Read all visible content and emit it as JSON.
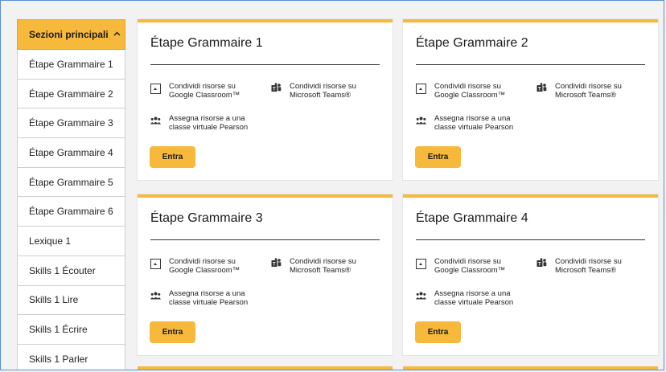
{
  "sidebar": {
    "header": "Sezioni principali",
    "items": [
      "Étape Grammaire 1",
      "Étape Grammaire 2",
      "Étape Grammaire 3",
      "Étape Grammaire 4",
      "Étape Grammaire 5",
      "Étape Grammaire 6",
      "Lexique 1",
      "Skills 1 Écouter",
      "Skills 1 Lire",
      "Skills 1 Écrire",
      "Skills 1 Parler"
    ]
  },
  "cards": [
    {
      "title": "Étape Grammaire 1"
    },
    {
      "title": "Étape Grammaire 2"
    },
    {
      "title": "Étape Grammaire 3"
    },
    {
      "title": "Étape Grammaire 4"
    }
  ],
  "resources": {
    "google_line1": "Condividi risorse su",
    "google_line2": "Google Classroom™",
    "teams_line1": "Condividi risorse su",
    "teams_line2": "Microsoft Teams®",
    "pearson_line1": "Assegna risorse a una",
    "pearson_line2": "classe virtuale Pearson"
  },
  "button_label": "Entra",
  "colors": {
    "accent": "#f6b93b",
    "frame": "#5a8fd6"
  }
}
